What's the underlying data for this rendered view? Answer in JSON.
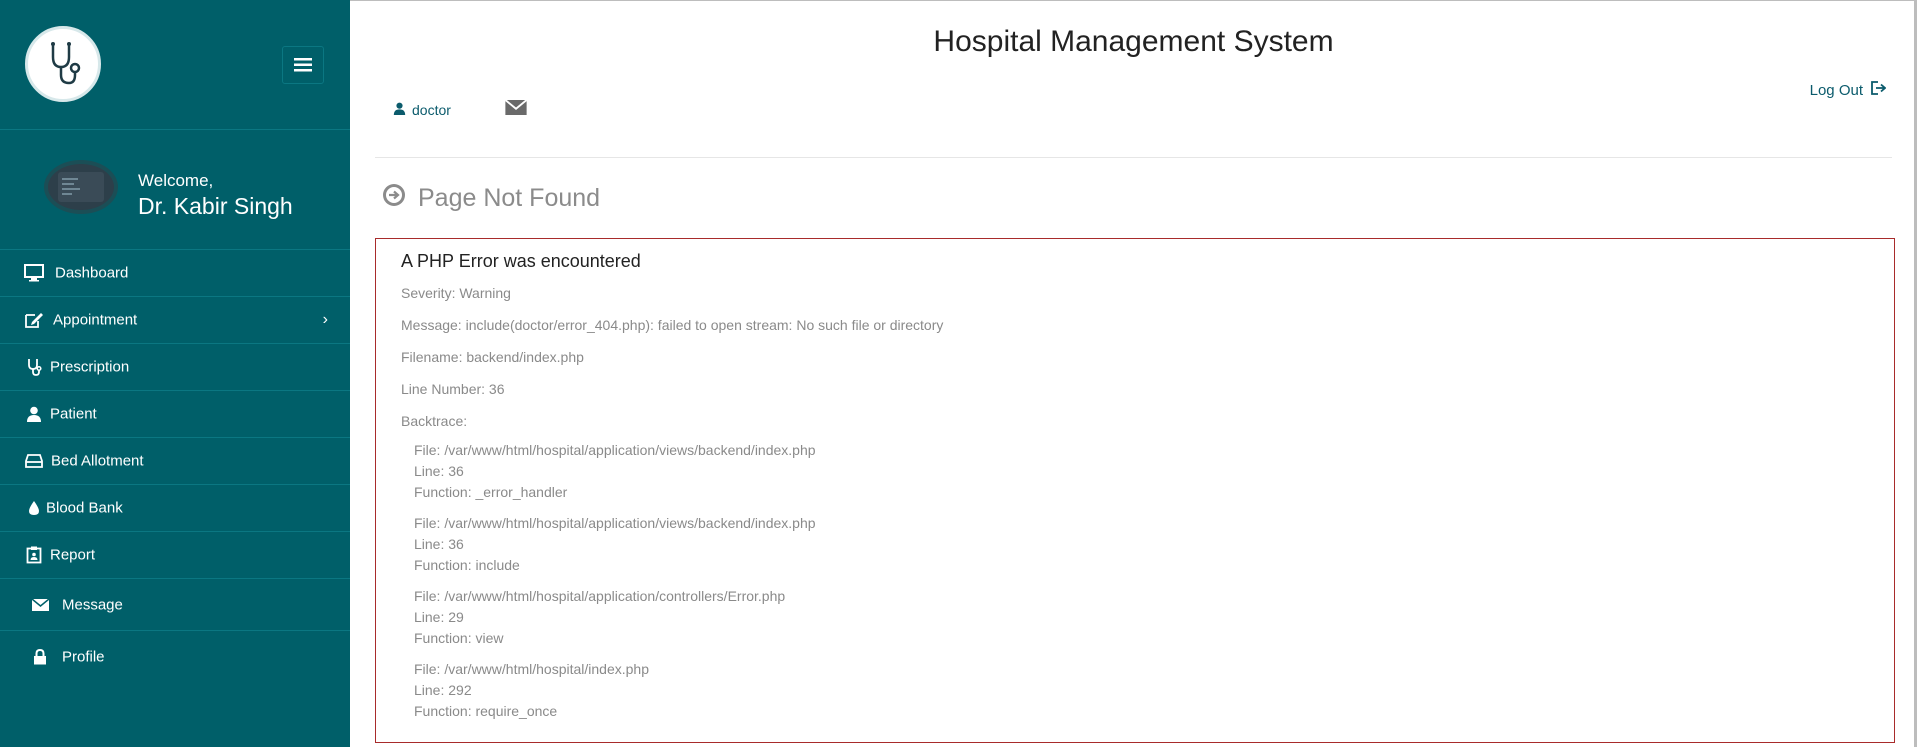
{
  "app": {
    "title": "Hospital Management System"
  },
  "sidebar": {
    "welcome_label": "Welcome,",
    "user_name": "Dr. Kabir Singh",
    "items": [
      {
        "label": "Dashboard",
        "icon": "monitor-icon"
      },
      {
        "label": "Appointment",
        "icon": "edit-icon",
        "has_submenu": true
      },
      {
        "label": "Prescription",
        "icon": "stethoscope-icon"
      },
      {
        "label": "Patient",
        "icon": "user-icon"
      },
      {
        "label": "Bed Allotment",
        "icon": "bed-icon"
      },
      {
        "label": "Blood Bank",
        "icon": "drop-icon"
      },
      {
        "label": "Report",
        "icon": "clipboard-icon"
      },
      {
        "label": "Message",
        "icon": "envelope-icon"
      },
      {
        "label": "Profile",
        "icon": "lock-icon"
      }
    ],
    "submenu_chevron": "›"
  },
  "header": {
    "user_role": "doctor",
    "logout_label": "Log Out"
  },
  "page": {
    "heading": "Page Not Found"
  },
  "error": {
    "title": "A PHP Error was encountered",
    "severity": "Severity: Warning",
    "message": "Message: include(doctor/error_404.php): failed to open stream: No such file or directory",
    "filename": "Filename: backend/index.php",
    "line_number": "Line Number: 36",
    "backtrace_label": "Backtrace:",
    "backtrace": [
      {
        "file": "File: /var/www/html/hospital/application/views/backend/index.php",
        "line": "Line: 36",
        "function": "Function: _error_handler"
      },
      {
        "file": "File: /var/www/html/hospital/application/views/backend/index.php",
        "line": "Line: 36",
        "function": "Function: include"
      },
      {
        "file": "File: /var/www/html/hospital/application/controllers/Error.php",
        "line": "Line: 29",
        "function": "Function: view"
      },
      {
        "file": "File: /var/www/html/hospital/index.php",
        "line": "Line: 292",
        "function": "Function: require_once"
      }
    ]
  },
  "colors": {
    "sidebar_bg": "#005f69",
    "error_border": "#a82b2b",
    "link": "#0b5b6c"
  }
}
